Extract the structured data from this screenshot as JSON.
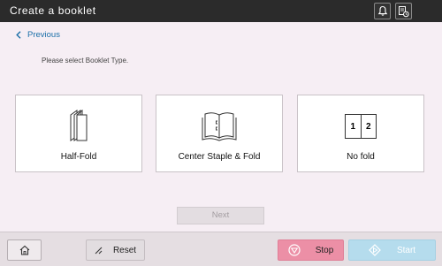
{
  "header": {
    "title": "Create a booklet",
    "icons": [
      "bell-icon",
      "job-status-icon"
    ]
  },
  "nav": {
    "previous_label": "Previous"
  },
  "prompt": "Please select Booklet Type.",
  "options": [
    {
      "label": "Half-Fold",
      "icon": "half-fold-icon"
    },
    {
      "label": "Center Staple & Fold",
      "icon": "center-staple-fold-icon"
    },
    {
      "label": "No fold",
      "icon": "no-fold-icon",
      "page_numbers": [
        "1",
        "2"
      ]
    }
  ],
  "next_label": "Next",
  "footer": {
    "home_icon": "home-icon",
    "reset_label": "Reset",
    "stop_label": "Stop",
    "start_label": "Start"
  },
  "colors": {
    "titlebar": "#2b2b2b",
    "background": "#f6eef4",
    "link": "#1b6fa8",
    "stop": "#ec8fa6",
    "start": "#b5dced"
  }
}
